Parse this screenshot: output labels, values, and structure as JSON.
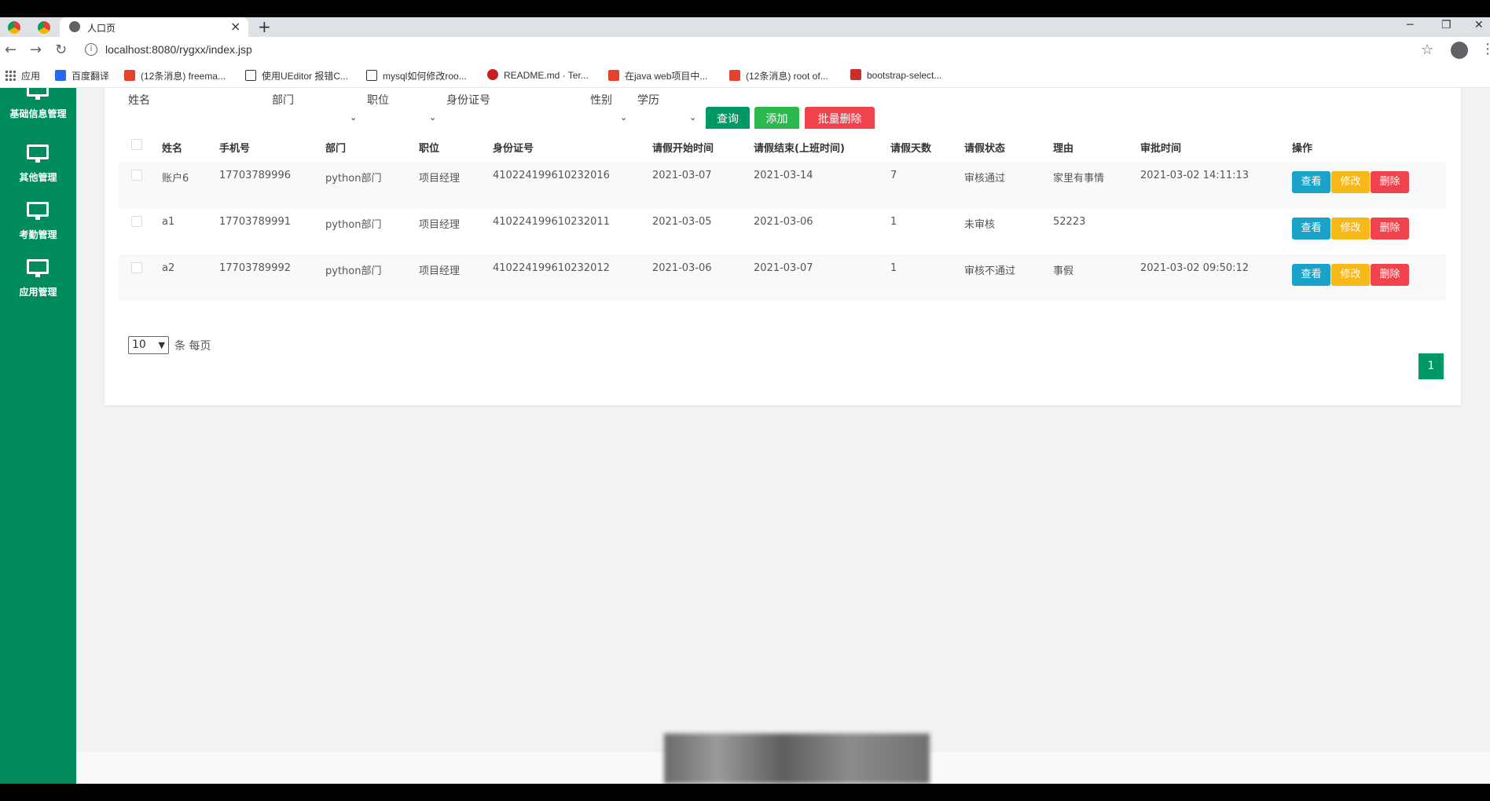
{
  "browser": {
    "tab_title": "人口页",
    "tab_close": "×",
    "new_tab": "+",
    "window_controls": {
      "minimize": "─",
      "restore": "❐",
      "close": "✕"
    },
    "nav": {
      "back": "←",
      "forward": "→",
      "reload": "↻"
    },
    "url": "localhost:8080/rygxx/index.jsp",
    "bookmarks": [
      {
        "label": "应用",
        "color": "#5f6368"
      },
      {
        "label": "百度翻译",
        "color": "#2468f2"
      },
      {
        "label": "(12条消息) freema...",
        "color": "#e8412c"
      },
      {
        "label": "使用UEditor 报错C...",
        "color": "#333333"
      },
      {
        "label": "mysql如何修改roo...",
        "color": "#333333"
      },
      {
        "label": "README.md · Ter...",
        "color": "#c71d23"
      },
      {
        "label": "在java web项目中...",
        "color": "#e8412c"
      },
      {
        "label": "(12条消息) root of...",
        "color": "#e8412c"
      },
      {
        "label": "bootstrap-select...",
        "color": "#c9302c"
      }
    ]
  },
  "sidebar": {
    "items": [
      {
        "label": "基础信息管理",
        "icon": "monitor-icon"
      },
      {
        "label": "其他管理",
        "icon": "monitor-icon"
      },
      {
        "label": "考勤管理",
        "icon": "monitor-icon"
      },
      {
        "label": "应用管理",
        "icon": "monitor-icon"
      }
    ]
  },
  "filters": {
    "name_label": "姓名",
    "dept_label": "部门",
    "position_label": "职位",
    "idcard_label": "身份证号",
    "gender_label": "性别",
    "edu_label": "学历",
    "chevron": "⌄"
  },
  "actions": {
    "query": "查询",
    "add": "添加",
    "batch_delete": "批量删除"
  },
  "table": {
    "headers": [
      "姓名",
      "手机号",
      "部门",
      "职位",
      "身份证号",
      "请假开始时间",
      "请假结束(上班时间)",
      "请假天数",
      "请假状态",
      "理由",
      "审批时间",
      "操作"
    ],
    "rows": [
      {
        "name": "账户6",
        "phone": "17703789996",
        "dept": "python部门",
        "position": "项目经理",
        "idcard": "410224199610232016",
        "start": "2021-03-07",
        "end": "2021-03-14",
        "days": "7",
        "status": "审核通过",
        "reason": "家里有事情",
        "approved": "2021-03-02 14:11:13"
      },
      {
        "name": "a1",
        "phone": "17703789991",
        "dept": "python部门",
        "position": "项目经理",
        "idcard": "410224199610232011",
        "start": "2021-03-05",
        "end": "2021-03-06",
        "days": "1",
        "status": "未审核",
        "reason": "52223",
        "approved": ""
      },
      {
        "name": "a2",
        "phone": "17703789992",
        "dept": "python部门",
        "position": "项目经理",
        "idcard": "410224199610232012",
        "start": "2021-03-06",
        "end": "2021-03-07",
        "days": "1",
        "status": "审核不通过",
        "reason": "事假",
        "approved": "2021-03-02 09:50:12"
      }
    ],
    "row_actions": {
      "view": "查看",
      "edit": "修改",
      "delete": "删除"
    }
  },
  "pagination": {
    "page_size": "10",
    "page_size_suffix": "条 每页",
    "current_page": "1"
  },
  "colors": {
    "sidebar": "#008c5a",
    "query": "#009966",
    "add": "#2db84d",
    "danger": "#f0434d",
    "view": "#1aa2c8",
    "edit": "#f7b81a"
  }
}
